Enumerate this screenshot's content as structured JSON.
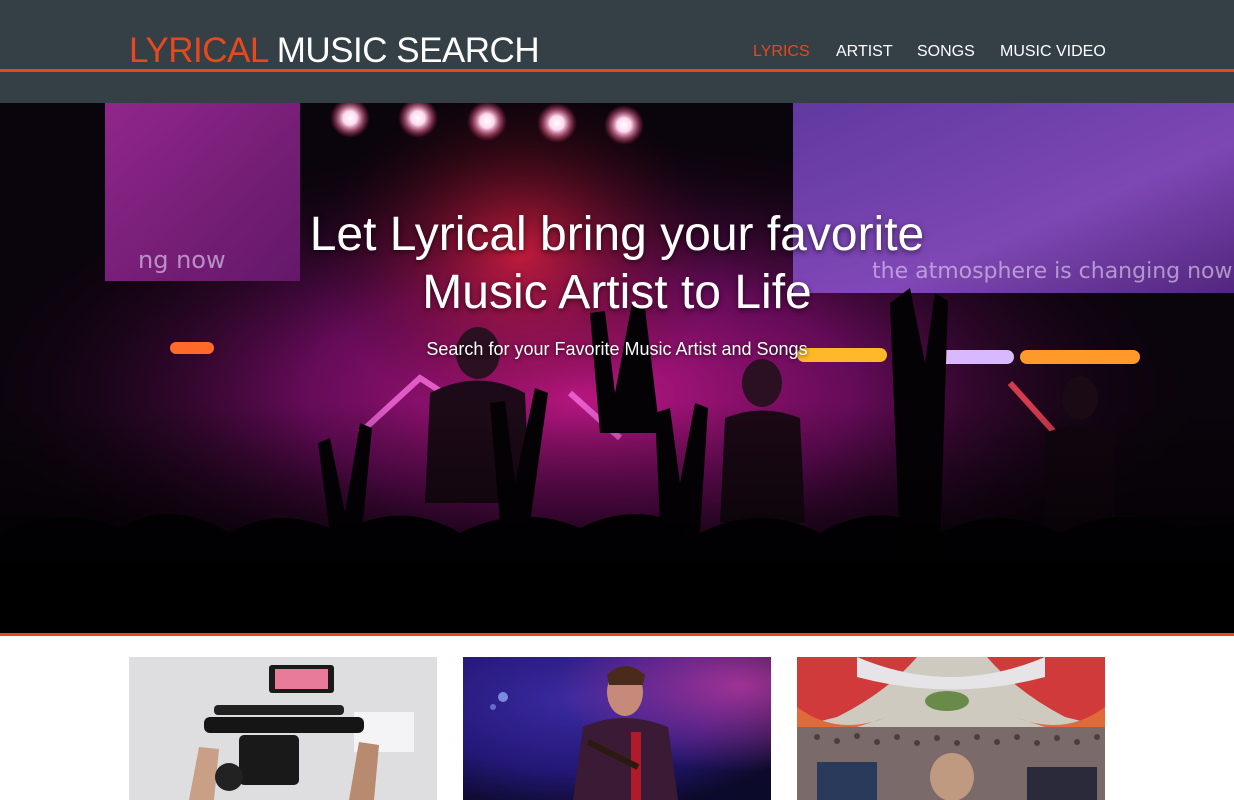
{
  "header": {
    "logo_accent": "LYRICAL",
    "logo_main": "MUSIC SEARCH",
    "accent_color": "#e8481e",
    "background_color": "#353f46"
  },
  "nav": {
    "items": [
      {
        "label": "LYRICS",
        "active": true
      },
      {
        "label": "ARTIST",
        "active": false
      },
      {
        "label": "SONGS",
        "active": false
      },
      {
        "label": "MUSIC VIDEO",
        "active": false
      }
    ]
  },
  "hero": {
    "title": "Let Lyrical bring your favorite Music Artist to Life",
    "subtitle": "Search for your Favorite Music Artist and Songs",
    "background_image": "concert-crowd-photo",
    "screen_text_left": "ng now",
    "screen_text_right": "the atmosphere is changing now"
  },
  "cards": [
    {
      "image": "video-camera-rig-photo"
    },
    {
      "image": "guitarist-on-stage-photo"
    },
    {
      "image": "festival-crowd-photo"
    }
  ]
}
